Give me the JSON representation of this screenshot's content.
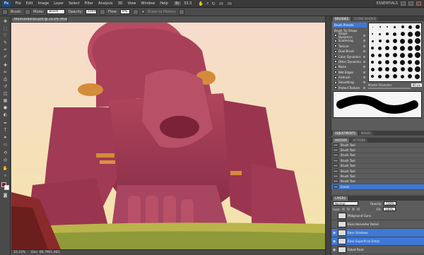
{
  "app": {
    "logo": "Ps",
    "workspace": "ESSENTIALS",
    "zoom": "33.3"
  },
  "menu": [
    "File",
    "Edit",
    "Image",
    "Layer",
    "Select",
    "Filter",
    "Analysis",
    "3D",
    "View",
    "Window",
    "Help"
  ],
  "options_bar": {
    "brush_label": "Brush:",
    "mode_label": "Mode:",
    "mode_value": "Brush",
    "opacity_label": "Opacity:",
    "opacity_value": "100%",
    "flow_label": "Flow:",
    "flow_value": "9%",
    "erase_history": "Erase to History"
  },
  "document": {
    "tab_title": "titanGarbanzo.psd @ 33.3% (RGB/8)*",
    "status_zoom": "33.33%",
    "status_doc": "Doc: 68.7M/1.46G"
  },
  "colors": {
    "foreground": "#7a1a2a",
    "background": "#ffffff",
    "accent": "#3e78d6"
  },
  "brushes_panel": {
    "tabs": [
      "BRUSHES",
      "CLONE SOURCE"
    ],
    "items": [
      {
        "label": "Brush Presets",
        "checkbox": false,
        "highlight": true
      },
      {
        "label": "Brush Tip Shape",
        "checkbox": false,
        "highlight": false
      },
      {
        "label": "Shape Dynamics",
        "checkbox": true,
        "highlight": false
      },
      {
        "label": "Scattering",
        "checkbox": true,
        "highlight": false
      },
      {
        "label": "Texture",
        "checkbox": true,
        "highlight": false
      },
      {
        "label": "Dual Brush",
        "checkbox": true,
        "highlight": false
      },
      {
        "label": "Color Dynamics",
        "checkbox": true,
        "highlight": false
      },
      {
        "label": "Other Dynamics",
        "checkbox": true,
        "highlight": false
      },
      {
        "label": "Noise",
        "checkbox": true,
        "highlight": false
      },
      {
        "label": "Wet Edges",
        "checkbox": true,
        "highlight": false
      },
      {
        "label": "Airbrush",
        "checkbox": true,
        "highlight": false
      },
      {
        "label": "Smoothing",
        "checkbox": true,
        "highlight": false
      },
      {
        "label": "Protect Texture",
        "checkbox": true,
        "highlight": false
      }
    ],
    "master_diameter_label": "Master Diameter",
    "master_diameter_value": "60 px"
  },
  "adjustments_tabs": [
    "ADJUSTMENTS",
    "MASKS"
  ],
  "history_panel": {
    "tabs": [
      "HISTORY",
      "ACTIONS"
    ],
    "items": [
      {
        "label": "Brush Tool",
        "highlight": false
      },
      {
        "label": "Brush Tool",
        "highlight": false
      },
      {
        "label": "Brush Tool",
        "highlight": false
      },
      {
        "label": "Brush Tool",
        "highlight": false
      },
      {
        "label": "Brush Tool",
        "highlight": false
      },
      {
        "label": "Brush Tool",
        "highlight": false
      },
      {
        "label": "Brush Tool",
        "highlight": false
      },
      {
        "label": "Brush Tool",
        "highlight": false
      },
      {
        "label": "Eraser",
        "highlight": true
      }
    ]
  },
  "layers_panel": {
    "tabs": [
      "LAYERS"
    ],
    "blend_mode": "Normal",
    "opacity_label": "Opacity:",
    "opacity_value": "100%",
    "fill_label": "Fill:",
    "fill_value": "100%",
    "lock_label": "Lock:",
    "items": [
      {
        "label": "Midground Guns",
        "visible": false,
        "highlight": false
      },
      {
        "label": "Base Harvester Detail",
        "visible": false,
        "highlight": false
      },
      {
        "label": "Base Shadows",
        "visible": true,
        "highlight": true
      },
      {
        "label": "Base Superficial Detail",
        "visible": true,
        "highlight": true
      },
      {
        "label": "Robot Paint",
        "visible": true,
        "highlight": false
      }
    ]
  }
}
